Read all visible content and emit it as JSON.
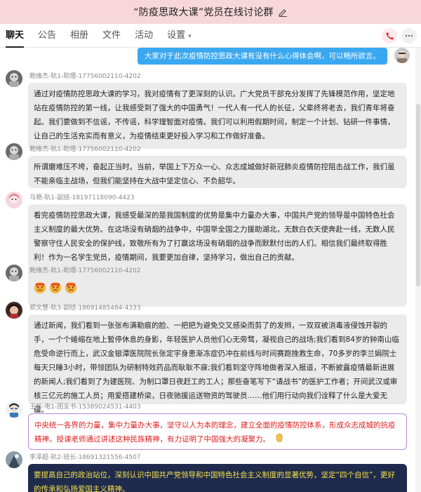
{
  "header": {
    "title": "“防疫思政大课”党员在线讨论群"
  },
  "tabs": [
    {
      "label": "聊天",
      "active": true
    },
    {
      "label": "公告"
    },
    {
      "label": "相册"
    },
    {
      "label": "文件"
    },
    {
      "label": "活动"
    },
    {
      "label": "设置"
    }
  ],
  "messages": {
    "mine": "大家对于此次疫情防控思政大课有没有什么心得体会啊，可以畅所欲言。",
    "m1": {
      "sender": "鲍缘杰-轨1-助理-17756002110-4202",
      "text": "通过对疫情防控思政大课的学习，我对疫情有了更深刻的认识。广大党员干部充分发挥了先锋模范作用，坚定地站在疫情防控的第一线，让我感受到了强大的中国勇气！一代人有一代人的长征，父辈终将老去，我们青年将奋起。我们要做到不信谣，不传谣，科学理智面对疫情。我们可以利用假期时间，制定一个计划、钻研一件事情，让自己的生活充实而有意义，为疫情结束更好投入学习和工作做好准备。"
    },
    "m2": {
      "sender": "鲍缘杰-轨1-助理-17756002110-4202",
      "text": "所谓磨难压不垮，奋起正当时。当前，举国上下万众一心、众志成城做好新冠肺炎疫情防控阻击战工作，我们虽不能亲临主战场，但我们能坚持在大战中坚定信心、不负韶华。"
    },
    "m3": {
      "sender": "马艳-轨1-副班-18197118090-4423",
      "text": "看完疫情防控思政大课，我感受最深的是我国制度的优势是集中力量办大事，中国共产党的领导是中国特色社会主义制度的最大优势。在这场没有硝烟的战争中，中国举全国之力援助湖北，无数白衣天使奔赴一线，无数人民警察守住人民安全的保护线，致敬所有为了打赢这场没有硝烟的战争而默默付出的人们。相信我们最终取得胜利！作为一名学生党员，疫情期间，我要更加自律，坚持学习，做出自己的贡献。"
    },
    "m4": {
      "sender": "鲍缘杰-轨1-助理-17756002110-4202"
    },
    "m5": {
      "sender": "郑文慧-轨3-副班-18691485484-4333",
      "text": "通过新闻，我们看到一张张布满勒痕的脸、一把把为避免交叉感染而剪了的发辫，一双双被消毒液侵蚀开裂的手，一个个蜷缩在地上暂停休息的身影，年轻医护人员他们心无旁骛，凝视自己的战场;我们看到84岁的钟南山临危受命逆行而上，武汉金银潭医院院长张定宇身患渐冻症仍冲在前线与时间赛跑挽救生命，70多岁的李兰娟院士每天只睡3小时，带领团队为研制特效药品而耿耿不寐;我们看到坚守阵地做者深入报道，不断披露疫情最新进展的新闻人;我们看到了为建医院、为制口罩日夜赶工的工人；那些奋笔写下“请战书”的医护工作者；开间武汉或审核三亿元的施工人员；用爱搭建桥梁，日夜驰援运送物资的驾驶员……他们用行动向我们诠释了什么是大爱无疆。"
    },
    "m6": {
      "sender": "王松-电1-团支书-15389024531-4403",
      "text": "中央统一各界的力量，集中力量办大事，坚守以人为本的理念，建立全面的疫情防控体系，形成众志成城的抗疫精神。授课老师通过讲述这种民族精神，有力证明了中国强大的凝聚力。"
    },
    "m7": {
      "sender": "李泽超-轨2-班长-18691321556-4507",
      "text": "要提高自己的政治站位，深刻认识中国共产党领导和中国特色社会主义制度的显著优势，坚定“四个自信”，更好的传承和弘扬爱国主义精神。"
    }
  },
  "colors": {
    "titlebar_bg": "#f7d7da",
    "mine_bubble": "#3aa8f0",
    "bubble_bg": "#ebebeb",
    "highlight_border": "#b78ad8",
    "highlight_text": "#e02020",
    "dark_bubble": "#1f2b4d",
    "dark_bubble_text": "#f5e04a"
  },
  "icons": [
    "edit-icon",
    "phone-icon",
    "more-icon",
    "dropdown-caret-icon",
    "angry-emoji-icon",
    "hand-emoji-icon"
  ]
}
